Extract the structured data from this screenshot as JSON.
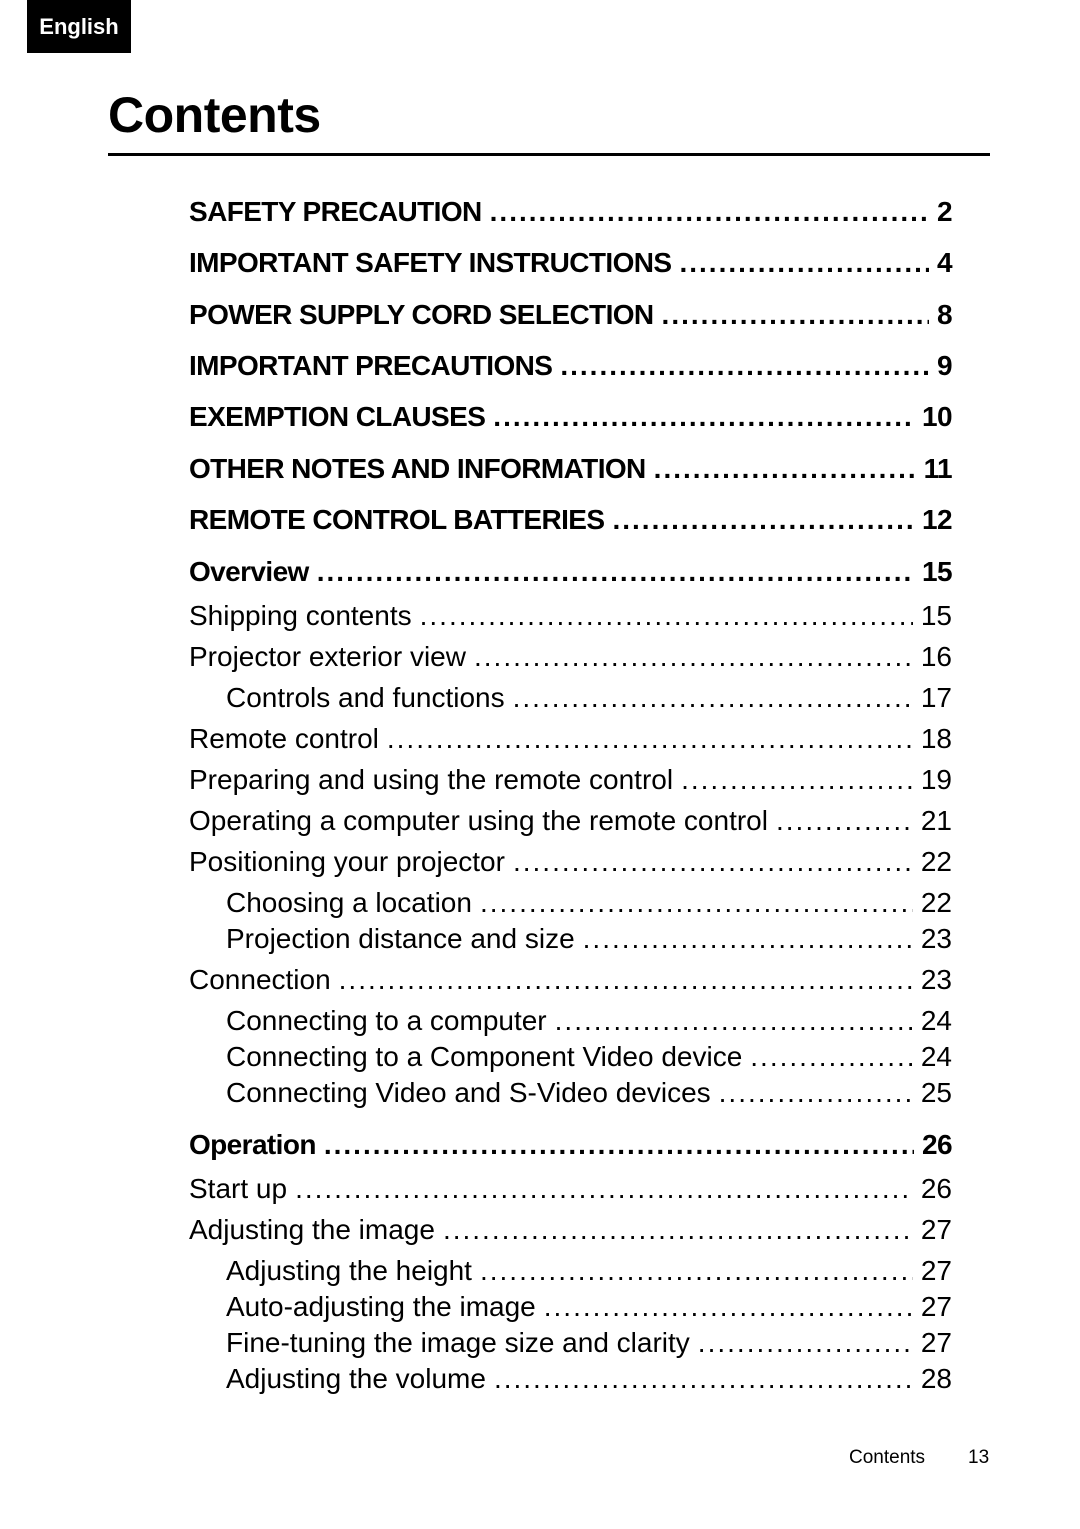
{
  "language_badge": "English",
  "title": "Contents",
  "toc": [
    {
      "label": "SAFETY PRECAUTION",
      "page": "2",
      "level": "major"
    },
    {
      "label": "IMPORTANT SAFETY INSTRUCTIONS",
      "page": "4",
      "level": "major"
    },
    {
      "label": "POWER SUPPLY CORD SELECTION",
      "page": "8",
      "level": "major"
    },
    {
      "label": "IMPORTANT PRECAUTIONS",
      "page": "9",
      "level": "major"
    },
    {
      "label": "EXEMPTION CLAUSES",
      "page": "10",
      "level": "major"
    },
    {
      "label": "OTHER NOTES AND INFORMATION",
      "page": "11",
      "level": "major"
    },
    {
      "label": "REMOTE CONTROL BATTERIES",
      "page": "12",
      "level": "major"
    },
    {
      "label": "Overview",
      "page": "15",
      "level": "section"
    },
    {
      "label": "Shipping contents",
      "page": "15",
      "level": "normal"
    },
    {
      "label": "Projector exterior view",
      "page": "16",
      "level": "normal"
    },
    {
      "label": "Controls and functions",
      "page": "17",
      "level": "sub"
    },
    {
      "label": "Remote control",
      "page": "18",
      "level": "normal"
    },
    {
      "label": "Preparing and using the remote control",
      "page": "19",
      "level": "normal"
    },
    {
      "label": "Operating a computer using the remote control",
      "page": "21",
      "level": "normal"
    },
    {
      "label": "Positioning your projector",
      "page": "22",
      "level": "normal"
    },
    {
      "label": "Choosing a location",
      "page": "22",
      "level": "sub"
    },
    {
      "label": "Projection distance and size",
      "page": "23",
      "level": "sub"
    },
    {
      "label": "Connection",
      "page": "23",
      "level": "normal"
    },
    {
      "label": "Connecting to a computer",
      "page": "24",
      "level": "sub"
    },
    {
      "label": "Connecting to a Component Video device",
      "page": "24",
      "level": "sub"
    },
    {
      "label": "Connecting Video and S-Video devices",
      "page": "25",
      "level": "sub"
    },
    {
      "label": "Operation",
      "page": "26",
      "level": "section"
    },
    {
      "label": "Start up",
      "page": "26",
      "level": "normal"
    },
    {
      "label": "Adjusting the image",
      "page": "27",
      "level": "normal"
    },
    {
      "label": "Adjusting the height",
      "page": "27",
      "level": "sub"
    },
    {
      "label": "Auto-adjusting the image",
      "page": "27",
      "level": "sub"
    },
    {
      "label": "Fine-tuning the image size and clarity",
      "page": "27",
      "level": "sub"
    },
    {
      "label": "Adjusting the volume",
      "page": "28",
      "level": "sub"
    }
  ],
  "footer": {
    "label": "Contents",
    "page": "13"
  }
}
